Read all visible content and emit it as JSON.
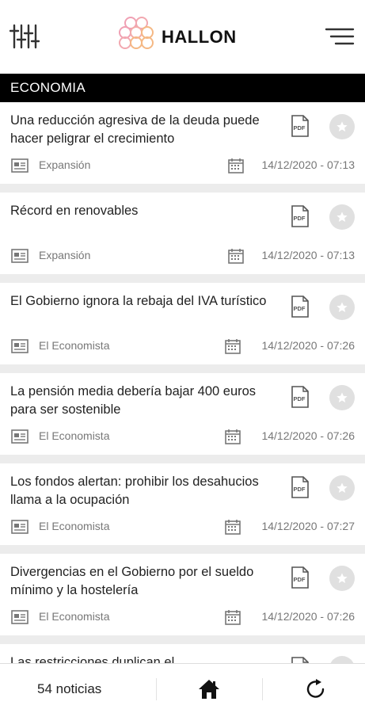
{
  "header": {
    "logo_text": "HALLON",
    "filter_icon": "sliders-icon",
    "menu_icon": "hamburger-menu-icon",
    "logo_color_a": "#f0a0b4",
    "logo_color_b": "#f5b884"
  },
  "section": {
    "title": "ECONOMIA"
  },
  "articles": [
    {
      "title": "Una reducción agresiva de la deuda puede hacer peligrar el crecimiento",
      "source": "Expansión",
      "date": "14/12/2020 - 07:13"
    },
    {
      "title": "Récord en renovables",
      "source": "Expansión",
      "date": "14/12/2020 - 07:13"
    },
    {
      "title": "El Gobierno ignora la rebaja del IVA turístico",
      "source": "El Economista",
      "date": "14/12/2020 - 07:26"
    },
    {
      "title": "La pensión media debería bajar 400 euros para ser sostenible",
      "source": "El Economista",
      "date": "14/12/2020 - 07:26"
    },
    {
      "title": "Los fondos alertan: prohibir los desahucios llama a la ocupación",
      "source": "El Economista",
      "date": "14/12/2020 - 07:27"
    },
    {
      "title": "Divergencias en el Gobierno por el sueldo mínimo y la hostelería",
      "source": "El Economista",
      "date": "14/12/2020 - 07:26"
    },
    {
      "title": "Las restricciones duplican el",
      "source": "",
      "date": ""
    }
  ],
  "footer": {
    "count": "54 noticias",
    "home_icon": "home-icon",
    "refresh_icon": "refresh-icon"
  }
}
